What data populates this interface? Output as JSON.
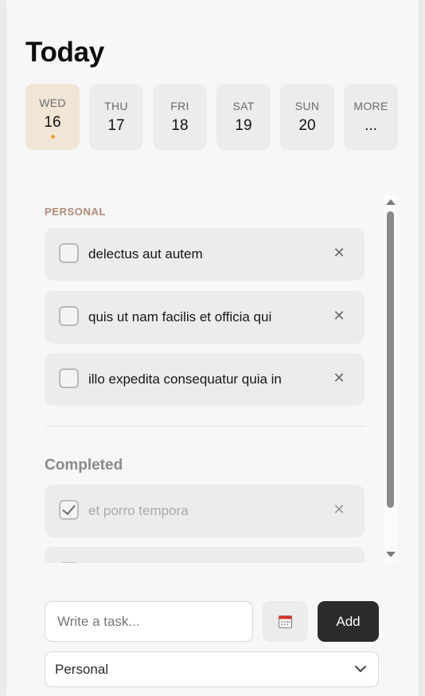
{
  "header": {
    "title": "Today"
  },
  "days": [
    {
      "name": "WED",
      "num": "16",
      "active": true
    },
    {
      "name": "THU",
      "num": "17"
    },
    {
      "name": "FRI",
      "num": "18"
    },
    {
      "name": "SAT",
      "num": "19"
    },
    {
      "name": "SUN",
      "num": "20"
    },
    {
      "name": "MORE",
      "num": "..."
    }
  ],
  "list": {
    "category": "PERSONAL",
    "tasks": [
      {
        "text": "delectus aut autem",
        "done": false
      },
      {
        "text": "quis ut nam facilis et officia qui",
        "done": false
      },
      {
        "text": "illo expedita consequatur quia in",
        "done": false
      }
    ],
    "completed_label": "Completed",
    "completed": [
      {
        "text": "et porro tempora",
        "done": true
      }
    ],
    "delete_glyph": "✕"
  },
  "composer": {
    "placeholder": "Write a task...",
    "add_label": "Add",
    "category_selected": "Personal"
  },
  "colors": {
    "active_day_bg": "#f1e6d6",
    "accent_dot": "#f0a23c",
    "category_label": "#b08b79",
    "add_button": "#2b2b2b"
  }
}
